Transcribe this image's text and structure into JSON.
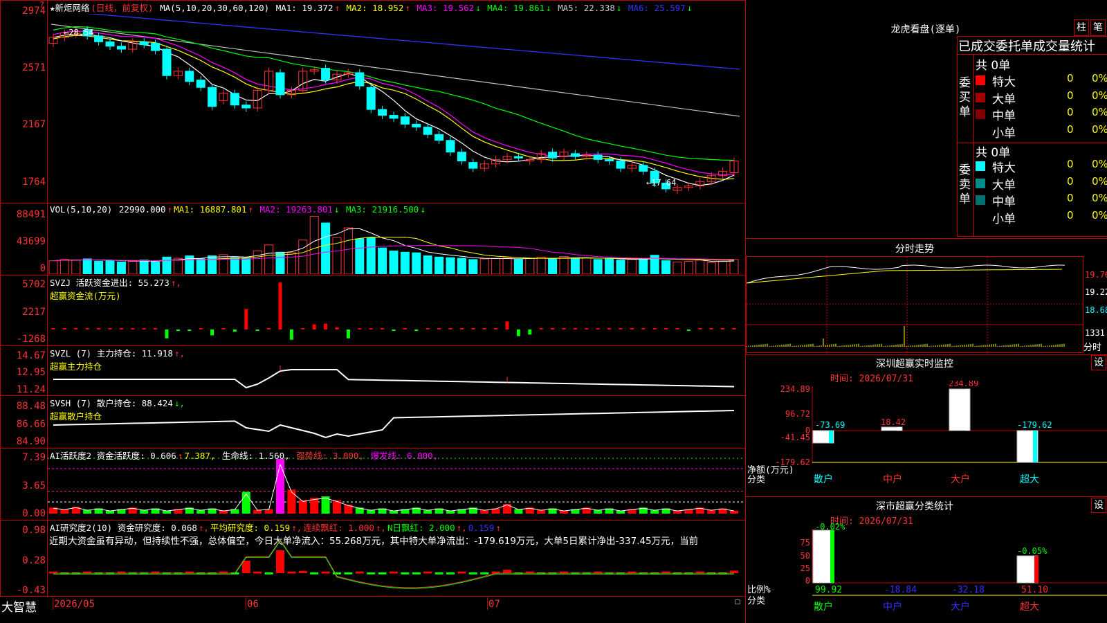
{
  "header": {
    "star_title": "★新炬网络",
    "mode": "(日线，前复权)",
    "ma_label": "MA(5,10,20,30,60,120)",
    "ma": [
      {
        "label": "MA1:",
        "value": "19.372",
        "arrow": "↑",
        "color": "#ffffff"
      },
      {
        "label": "MA2:",
        "value": "18.952",
        "arrow": "↑",
        "color": "#ffff00"
      },
      {
        "label": "MA3:",
        "value": "19.562",
        "arrow": "↓",
        "color": "#ff00ff"
      },
      {
        "label": "MA4:",
        "value": "19.861",
        "arrow": "↓",
        "color": "#00ff00"
      },
      {
        "label": "MA5:",
        "value": "22.338",
        "arrow": "↓",
        "color": "#cccccc"
      },
      {
        "label": "MA6:",
        "value": "25.597",
        "arrow": "↓",
        "color": "#3232ff"
      }
    ]
  },
  "price_axis": [
    "2974",
    "2571",
    "2167",
    "1764"
  ],
  "price_marks": {
    "high": "28.54",
    "low": "17.64"
  },
  "vol": {
    "label": "VOL(5,10,20)",
    "value": "22990.000",
    "arrow": "↑",
    "ma1": "MA1: 16887.801",
    "ma1_arrow": "↑",
    "ma2": "MA2: 19263.801",
    "ma2_arrow": "↓",
    "ma3": "MA3: 21916.500",
    "ma3_arrow": "↓",
    "axis": [
      "88491",
      "43699",
      "0"
    ]
  },
  "svzj": {
    "label": "SVZJ  活跃资金进出: 55.273",
    "arrow": "↑,",
    "sub": "超赢资金流(万元)",
    "axis": [
      "5702",
      "2217",
      "-1268"
    ]
  },
  "svzl": {
    "label": "SVZL (7) 主力持仓: 11.918",
    "arrow": "↑,",
    "sub": "超赢主力持仓",
    "axis": [
      "14.67",
      "12.95",
      "11.24"
    ]
  },
  "svsh": {
    "label": "SVSH (7) 散户持仓: 88.424",
    "arrow": "↓,",
    "sub": "超赢散户持仓",
    "axis": [
      "88.48",
      "86.66",
      "84.90"
    ]
  },
  "ai1": {
    "label": "AI活跃度2 资金活跃度: 0.606",
    "v2": "7.387,",
    "life": "生命线: 1.560,",
    "strong": "强势线: 3.000,",
    "burst": "爆发线: 6.000,",
    "axis": [
      "7.39",
      "3.65",
      "0.00"
    ]
  },
  "ai2": {
    "label": "AI研究度2(10) 资金研究度: 0.068",
    "avg": "平均研究度: 0.159",
    "cont": "连续飘红: 1.000",
    "nday": "N日飘红: 2.000",
    "last": "0.159",
    "axis": [
      "0.98",
      "0.28",
      "-0.43"
    ],
    "text": "近期大资金虽有异动，但持续性不强，总体偏空，今日大单净流入：55.268万元，其中特大单净流出：-179.619万元，大单5日累计净出-337.45万元，当前"
  },
  "dates": [
    "2026/05",
    "06",
    "07"
  ],
  "brand": "大智慧",
  "right": {
    "lhb_title": "龙虎看盘(逐单)",
    "btn_zhu": "柱",
    "btn_bi": "笔",
    "section_title": "已成交委托单成交量统计",
    "buy_label": "委买单",
    "sell_label": "委卖单",
    "buy_total": "共 0单",
    "sell_total": "共 0单",
    "buy_rows": [
      {
        "name": "特大",
        "count": "0",
        "pct": "0%",
        "color": "#ff0000"
      },
      {
        "name": "大单",
        "count": "0",
        "pct": "0%",
        "color": "#a00000"
      },
      {
        "name": "中单",
        "count": "0",
        "pct": "0%",
        "color": "#800000"
      },
      {
        "name": "小单",
        "count": "0",
        "pct": "0%",
        "color": ""
      }
    ],
    "sell_rows": [
      {
        "name": "特大",
        "count": "0",
        "pct": "0%",
        "color": "#00ffff"
      },
      {
        "name": "大单",
        "count": "0",
        "pct": "0%",
        "color": "#008a8a"
      },
      {
        "name": "中单",
        "count": "0",
        "pct": "0%",
        "color": "#007070"
      },
      {
        "name": "小单",
        "count": "0",
        "pct": "0%",
        "color": ""
      }
    ],
    "fs_title": "分时走势",
    "fs_axis": [
      "19.76",
      "19.22",
      "18.68",
      "1331"
    ],
    "fs_unit": "分时",
    "sz_title": "深圳超赢实时监控",
    "set": "设",
    "sz_time": "时间: 2026/07/31",
    "sz_axis": [
      "234.89",
      "96.72",
      "0",
      "-41.45",
      "-179.62"
    ],
    "sz_vals": [
      "-73.69",
      "18.42",
      "234.89",
      "-179.62"
    ],
    "sz_ylab": "净额(万元)",
    "sz_xlab": "分类",
    "cats": [
      "散户",
      "中户",
      "大户",
      "超大"
    ],
    "sc_title": "深市超赢分类统计",
    "sc_time": "时间: 2026/07/31",
    "sc_axis": [
      "75",
      "50",
      "25",
      "0"
    ],
    "sc_top": [
      "-0.02%",
      "-0.05%"
    ],
    "sc_vals": [
      "99.92",
      "-18.84",
      "-32.18",
      "51.10"
    ],
    "sc_ylab": "比例%",
    "sc_xlab": "分类"
  }
}
